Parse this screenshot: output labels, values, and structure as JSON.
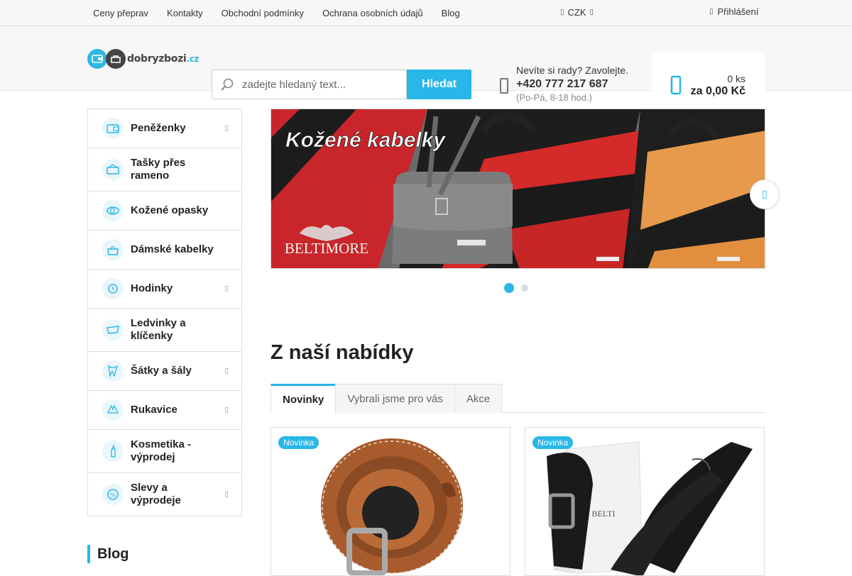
{
  "topbar": {
    "links": [
      "Ceny přeprav",
      "Kontakty",
      "Obchodní podmínky",
      "Ochrana osobních údajů",
      "Blog"
    ],
    "currency": "CZK",
    "login": "Přihlášení"
  },
  "header": {
    "logo_text": "dobryzbozi",
    "logo_tld": ".cz",
    "search_placeholder": "zadejte hledaný text...",
    "search_button": "Hledat",
    "help_question": "Nevíte si rady? Zavolejte.",
    "help_phone": "+420 777 217 687",
    "help_hours": "(Po-Pá, 8-18 hod.)",
    "cart_count": "0 ks",
    "cart_total": "za 0,00 Kč"
  },
  "sidebar": {
    "categories": [
      {
        "label": "Peněženky",
        "has_submenu": true,
        "icon": "wallet-icon"
      },
      {
        "label": "Tašky přes rameno",
        "has_submenu": false,
        "icon": "shoulder-bag-icon"
      },
      {
        "label": "Kožené opasky",
        "has_submenu": false,
        "icon": "belt-icon"
      },
      {
        "label": "Dámské kabelky",
        "has_submenu": false,
        "icon": "handbag-icon"
      },
      {
        "label": "Hodinky",
        "has_submenu": true,
        "icon": "watch-icon"
      },
      {
        "label": "Ledvinky a klíčenky",
        "has_submenu": false,
        "icon": "waist-bag-icon"
      },
      {
        "label": "Šátky a šály",
        "has_submenu": true,
        "icon": "scarf-icon"
      },
      {
        "label": "Rukavice",
        "has_submenu": true,
        "icon": "gloves-icon"
      },
      {
        "label": "Kosmetika - výprodej",
        "has_submenu": false,
        "icon": "cosmetics-icon"
      },
      {
        "label": "Slevy a výprodeje",
        "has_submenu": true,
        "icon": "discount-icon"
      }
    ],
    "blog_heading": "Blog"
  },
  "banner": {
    "headline": "Kožené kabelky",
    "brand": "BELTIMORE",
    "slide_count": 2,
    "active_slide": 1
  },
  "offers": {
    "title": "Z naší nabídky",
    "tabs": [
      "Novinky",
      "Vybrali jsme pro vás",
      "Akce"
    ],
    "active_tab": "Novinky",
    "products": [
      {
        "badge": "Novinka"
      },
      {
        "badge": "Novinka"
      }
    ]
  },
  "colors": {
    "accent": "#29b6e8",
    "dark": "#222222"
  }
}
